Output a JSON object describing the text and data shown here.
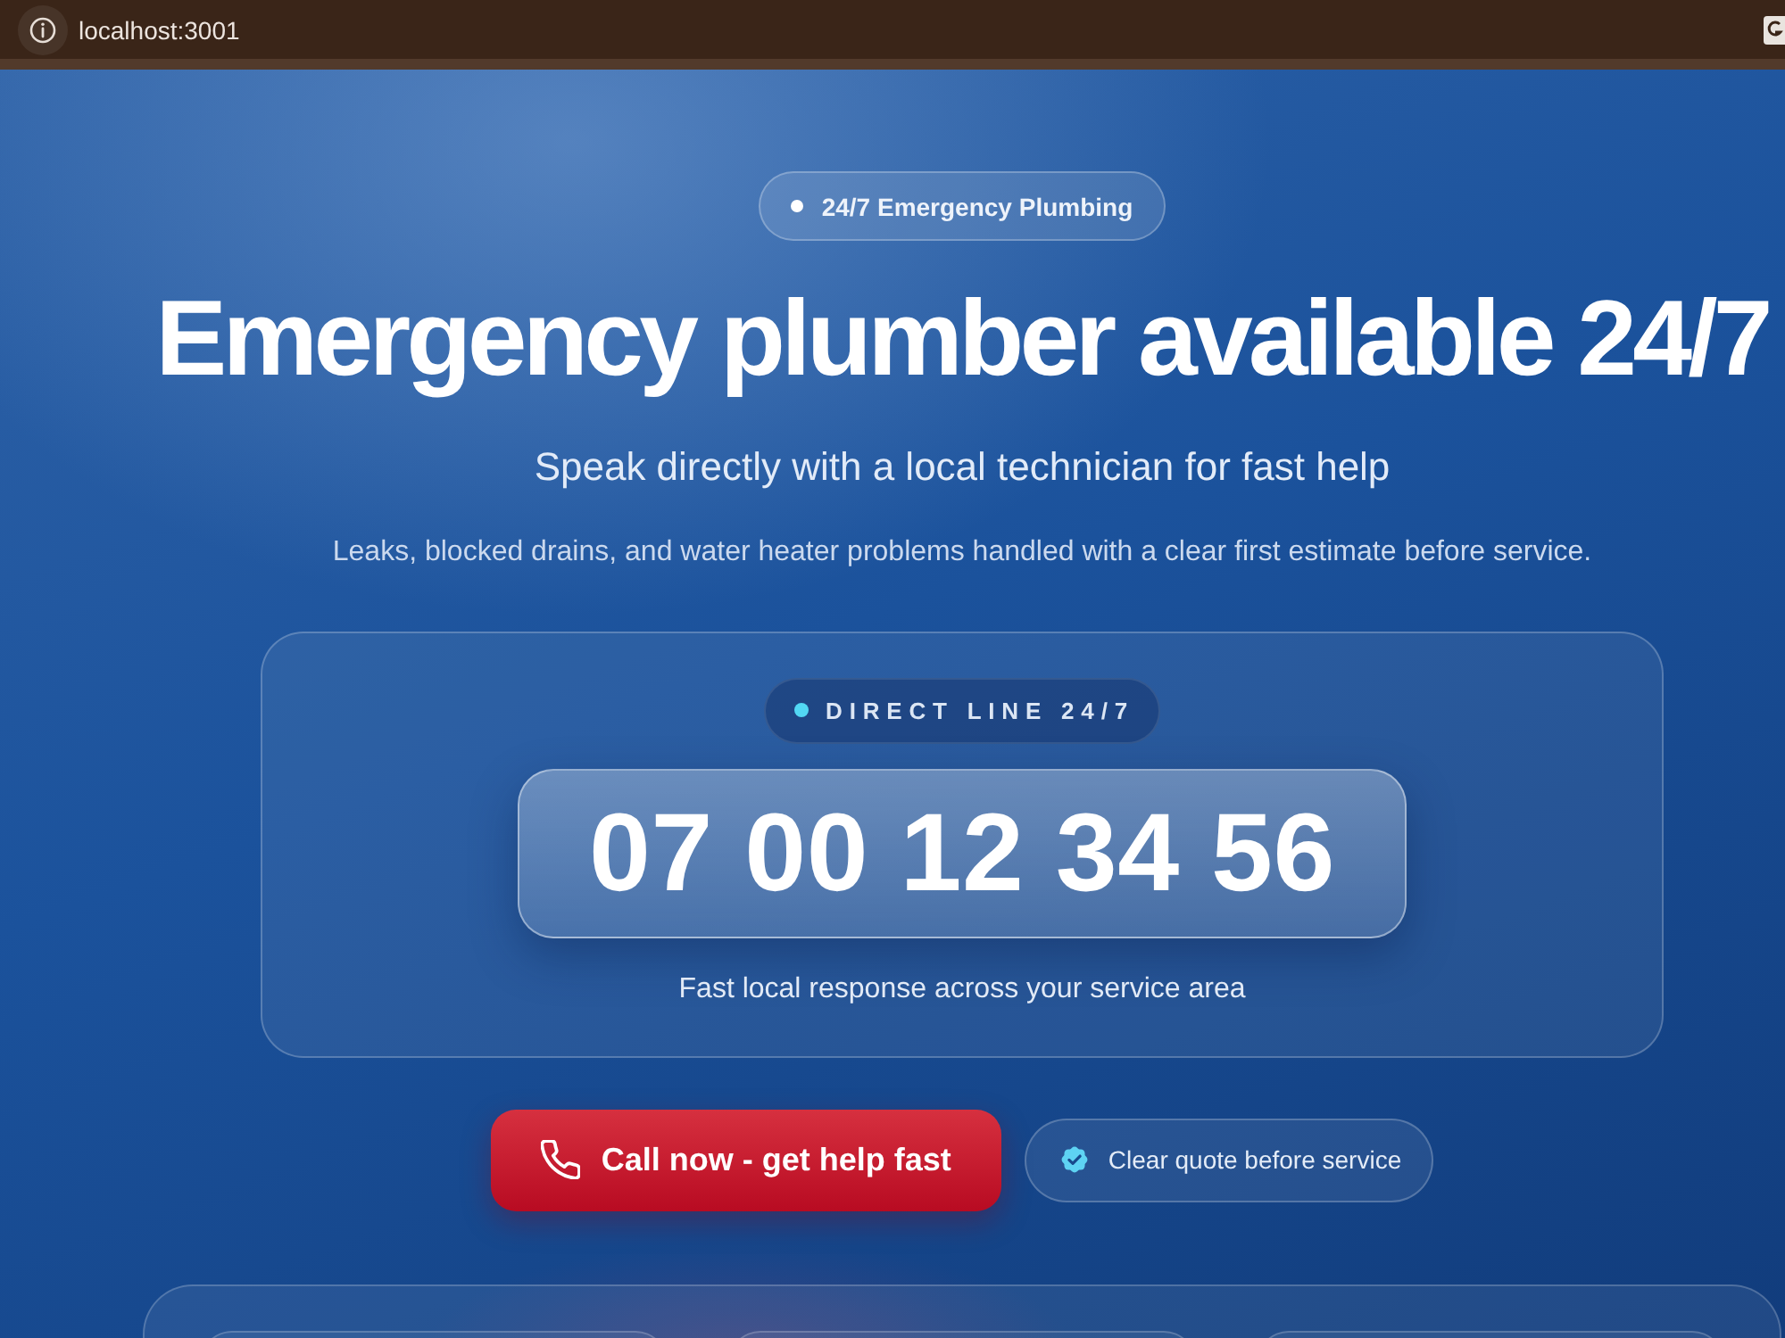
{
  "browser": {
    "url": "localhost:3001"
  },
  "hero": {
    "badge": "24/7 Emergency Plumbing",
    "title": "Emergency plumber available 24/7",
    "subtitle": "Speak directly with a local technician for fast help",
    "description": "Leaks, blocked drains, and water heater problems handled with a clear first estimate before service."
  },
  "contact_card": {
    "label": "DIRECT LINE 24/7",
    "phone_number": "07 00 12 34 56",
    "note": "Fast local response across your service area"
  },
  "actions": {
    "call_button": "Call now - get help fast",
    "quote_badge": "Clear quote before service"
  }
}
